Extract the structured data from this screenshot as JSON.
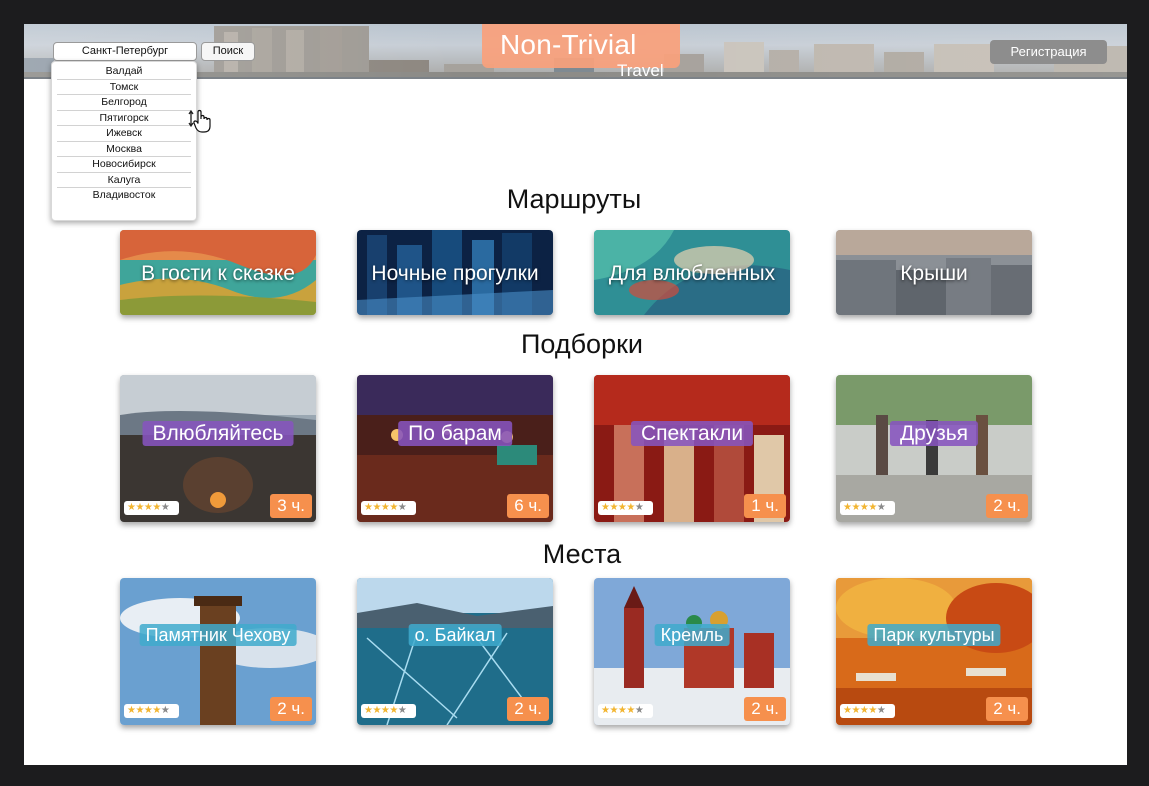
{
  "header": {
    "city_value": "Санкт-Петербург",
    "search_label": "Поиск",
    "logo_main": "Non-Trivial",
    "logo_sub": "Travel",
    "register_label": "Регистрация"
  },
  "dropdown": {
    "options": [
      "Валдай",
      "Томск",
      "Белгород",
      "Пятигорск",
      "Ижевск",
      "Москва",
      "Новосибирск",
      "Калуга",
      "Владивосток"
    ]
  },
  "sections": {
    "routes_title": "Маршруты",
    "collections_title": "Подборки",
    "places_title": "Места"
  },
  "routes": [
    {
      "label": "В гости к сказке"
    },
    {
      "label": "Ночные прогулки"
    },
    {
      "label": "Для влюбленных"
    },
    {
      "label": "Крыши"
    }
  ],
  "collections": [
    {
      "label": "Влюбляйтесь",
      "duration": "3 ч.",
      "rating": 4,
      "rating_max": 5
    },
    {
      "label": "По барам",
      "duration": "6 ч.",
      "rating": 4,
      "rating_max": 5
    },
    {
      "label": "Спектакли",
      "duration": "1 ч.",
      "rating": 4,
      "rating_max": 5
    },
    {
      "label": "Друзья",
      "duration": "2 ч.",
      "rating": 4,
      "rating_max": 5
    }
  ],
  "places": [
    {
      "label": "Памятник Чехову",
      "duration": "2 ч.",
      "rating": 4,
      "rating_max": 5
    },
    {
      "label": "о. Байкал",
      "duration": "2 ч.",
      "rating": 4,
      "rating_max": 5
    },
    {
      "label": "Кремль",
      "duration": "2 ч.",
      "rating": 4,
      "rating_max": 5
    },
    {
      "label": "Парк культуры",
      "duration": "2 ч.",
      "rating": 4,
      "rating_max": 5
    }
  ],
  "colors": {
    "accent_orange": "#f6904d",
    "logo_bg": "#f9a07c",
    "tag_purple": "#8654be",
    "tag_blue": "#3faacd",
    "star_on": "#f2b531",
    "star_off": "#8a8a8a"
  }
}
